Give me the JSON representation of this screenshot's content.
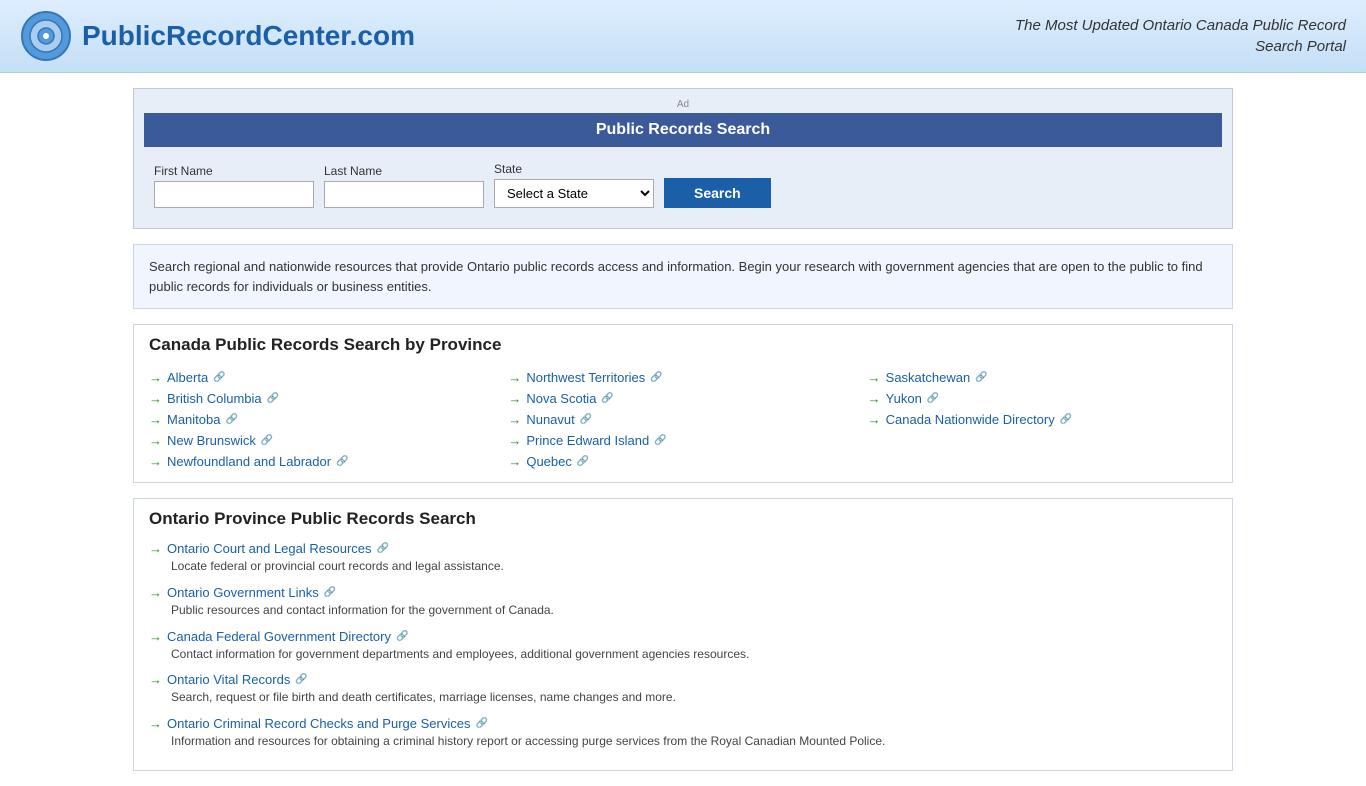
{
  "header": {
    "site_title": "PublicRecordCenter.com",
    "tagline_line1": "The Most Updated Ontario Canada Public Record",
    "tagline_line2": "Search Portal"
  },
  "ad": {
    "label": "Ad",
    "widget_title": "Public Records Search",
    "form": {
      "first_name_label": "First Name",
      "last_name_label": "Last Name",
      "state_label": "State",
      "state_default": "Select a State",
      "search_button": "Search"
    }
  },
  "description": "Search regional and nationwide resources that provide Ontario public records access and information. Begin your research with government agencies that are open to the public to find public records for individuals or business entities.",
  "province_section": {
    "title": "Canada Public Records Search by Province",
    "col1": [
      {
        "label": "Alberta",
        "ext": true
      },
      {
        "label": "British Columbia",
        "ext": true
      },
      {
        "label": "Manitoba",
        "ext": true
      },
      {
        "label": "New Brunswick",
        "ext": true
      },
      {
        "label": "Newfoundland and Labrador",
        "ext": true
      }
    ],
    "col2": [
      {
        "label": "Northwest Territories",
        "ext": true
      },
      {
        "label": "Nova Scotia",
        "ext": true
      },
      {
        "label": "Nunavut",
        "ext": true
      },
      {
        "label": "Prince Edward Island",
        "ext": true
      },
      {
        "label": "Quebec",
        "ext": true
      }
    ],
    "col3": [
      {
        "label": "Saskatchewan",
        "ext": true
      },
      {
        "label": "Yukon",
        "ext": true
      },
      {
        "label": "Canada Nationwide Directory",
        "ext": true
      }
    ]
  },
  "ontario_section": {
    "title": "Ontario Province Public Records Search",
    "items": [
      {
        "link": "Ontario Court and Legal Resources",
        "desc": "Locate federal or provincial court records and legal assistance.",
        "ext": true
      },
      {
        "link": "Ontario Government Links",
        "desc": "Public resources and contact information for the government of Canada.",
        "ext": true
      },
      {
        "link": "Canada Federal Government Directory",
        "desc": "Contact information for government departments and employees, additional government agencies resources.",
        "ext": true
      },
      {
        "link": "Ontario Vital Records",
        "desc": "Search, request or file birth and death certificates, marriage licenses, name changes and more.",
        "ext": true
      },
      {
        "link": "Ontario Criminal Record Checks and Purge Services",
        "desc": "Information and resources for obtaining a criminal history report or accessing purge services from the Royal Canadian Mounted Police.",
        "ext": true
      }
    ]
  }
}
